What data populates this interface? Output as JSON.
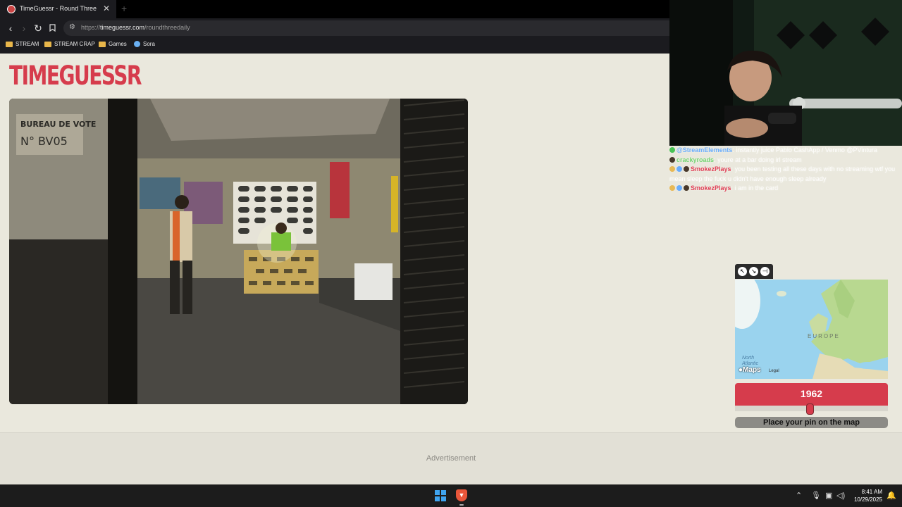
{
  "browser": {
    "tab_title": "TimeGuessr - Round Three",
    "tab_close": "✕",
    "new_tab": "+",
    "url_prefix": "https://",
    "url_domain": "timeguessr.com",
    "url_path": "/roundthreedaily",
    "bookmarks": [
      "STREAM",
      "STREAM CRAP",
      "Games",
      "Sora"
    ]
  },
  "page": {
    "logo": "TIMEGUESSR",
    "photo_sign_line1": "BUREAU DE VOTE",
    "photo_sign_line2": "N° BV05",
    "advertisement": "Advertisement"
  },
  "chat": [
    {
      "user": "@StreamElements",
      "message": "instantly juice Pablo CashApp / Venmo @PVintura",
      "user_color": "#5fa8ff"
    },
    {
      "user": "crackyroads",
      "message": "youre at a bar doing irl stream",
      "user_color": "#6ad46a"
    },
    {
      "user": "SmokezPlays",
      "message": "you been testing all these days with no streaming wtf you mean sleep the fuck u didn't have enough sleep already",
      "user_color": "#e0304a"
    },
    {
      "user": "SmokezPlays",
      "message": "i am in the card",
      "user_color": "#e0304a"
    }
  ],
  "map": {
    "region_label": "EUROPE",
    "ocean_label_1": "North",
    "ocean_label_2": "Atlantic",
    "logo": "Maps",
    "legal": "Legal",
    "tools": [
      "expand-icon",
      "shrink-icon",
      "pin-icon"
    ]
  },
  "game": {
    "year": "1962",
    "year_fraction": 0.49,
    "pin_prompt": "Place your pin on the map"
  },
  "taskbar": {
    "time": "8:41 AM",
    "date": "10/29/2025"
  },
  "colors": {
    "accent": "#d63c4c",
    "page_bg": "#eae8dd"
  }
}
